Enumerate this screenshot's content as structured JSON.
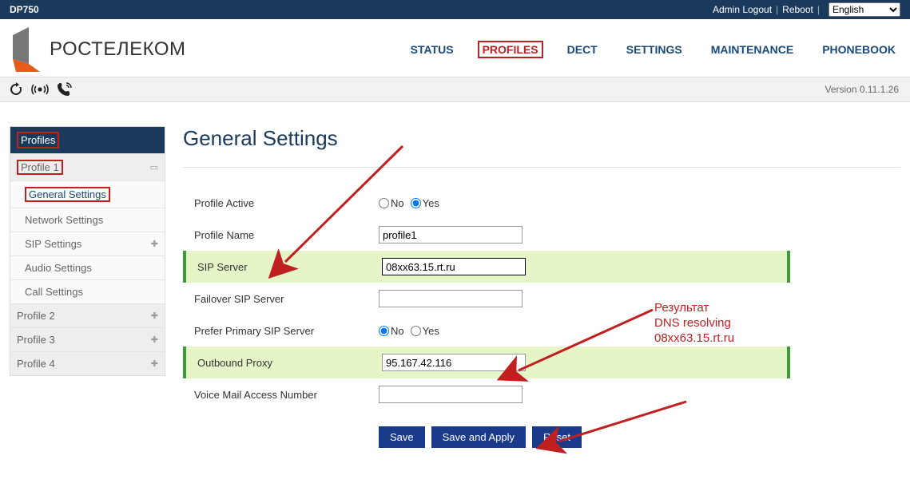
{
  "topbar": {
    "model": "DP750",
    "admin_logout": "Admin Logout",
    "reboot": "Reboot",
    "language": "English"
  },
  "nav": {
    "status": "STATUS",
    "profiles": "PROFILES",
    "dect": "DECT",
    "settings": "SETTINGS",
    "maintenance": "MAINTENANCE",
    "phonebook": "PHONEBOOK"
  },
  "logo_text": "РОСТЕЛЕКОМ",
  "version_label": "Version 0.11.1.26",
  "sidebar": {
    "head": "Profiles",
    "profile1": "Profile 1",
    "general_settings": "General Settings",
    "network_settings": "Network Settings",
    "sip_settings": "SIP Settings",
    "audio_settings": "Audio Settings",
    "call_settings": "Call Settings",
    "profile2": "Profile 2",
    "profile3": "Profile 3",
    "profile4": "Profile 4"
  },
  "page": {
    "title": "General Settings",
    "labels": {
      "profile_active": "Profile Active",
      "profile_name": "Profile Name",
      "sip_server": "SIP Server",
      "failover_sip": "Failover SIP Server",
      "prefer_primary": "Prefer Primary SIP Server",
      "outbound_proxy": "Outbound Proxy",
      "voicemail": "Voice Mail Access Number",
      "no": "No",
      "yes": "Yes"
    },
    "values": {
      "profile_name": "profile1",
      "sip_server": "08xx63.15.rt.ru",
      "failover_sip": "",
      "outbound_proxy": "95.167.42.116",
      "voicemail": ""
    },
    "buttons": {
      "save": "Save",
      "save_apply": "Save and Apply",
      "reset": "Reset"
    }
  },
  "annotation": {
    "line1": "Результат",
    "line2": "DNS resolving",
    "line3": "08xx63.15.rt.ru"
  }
}
